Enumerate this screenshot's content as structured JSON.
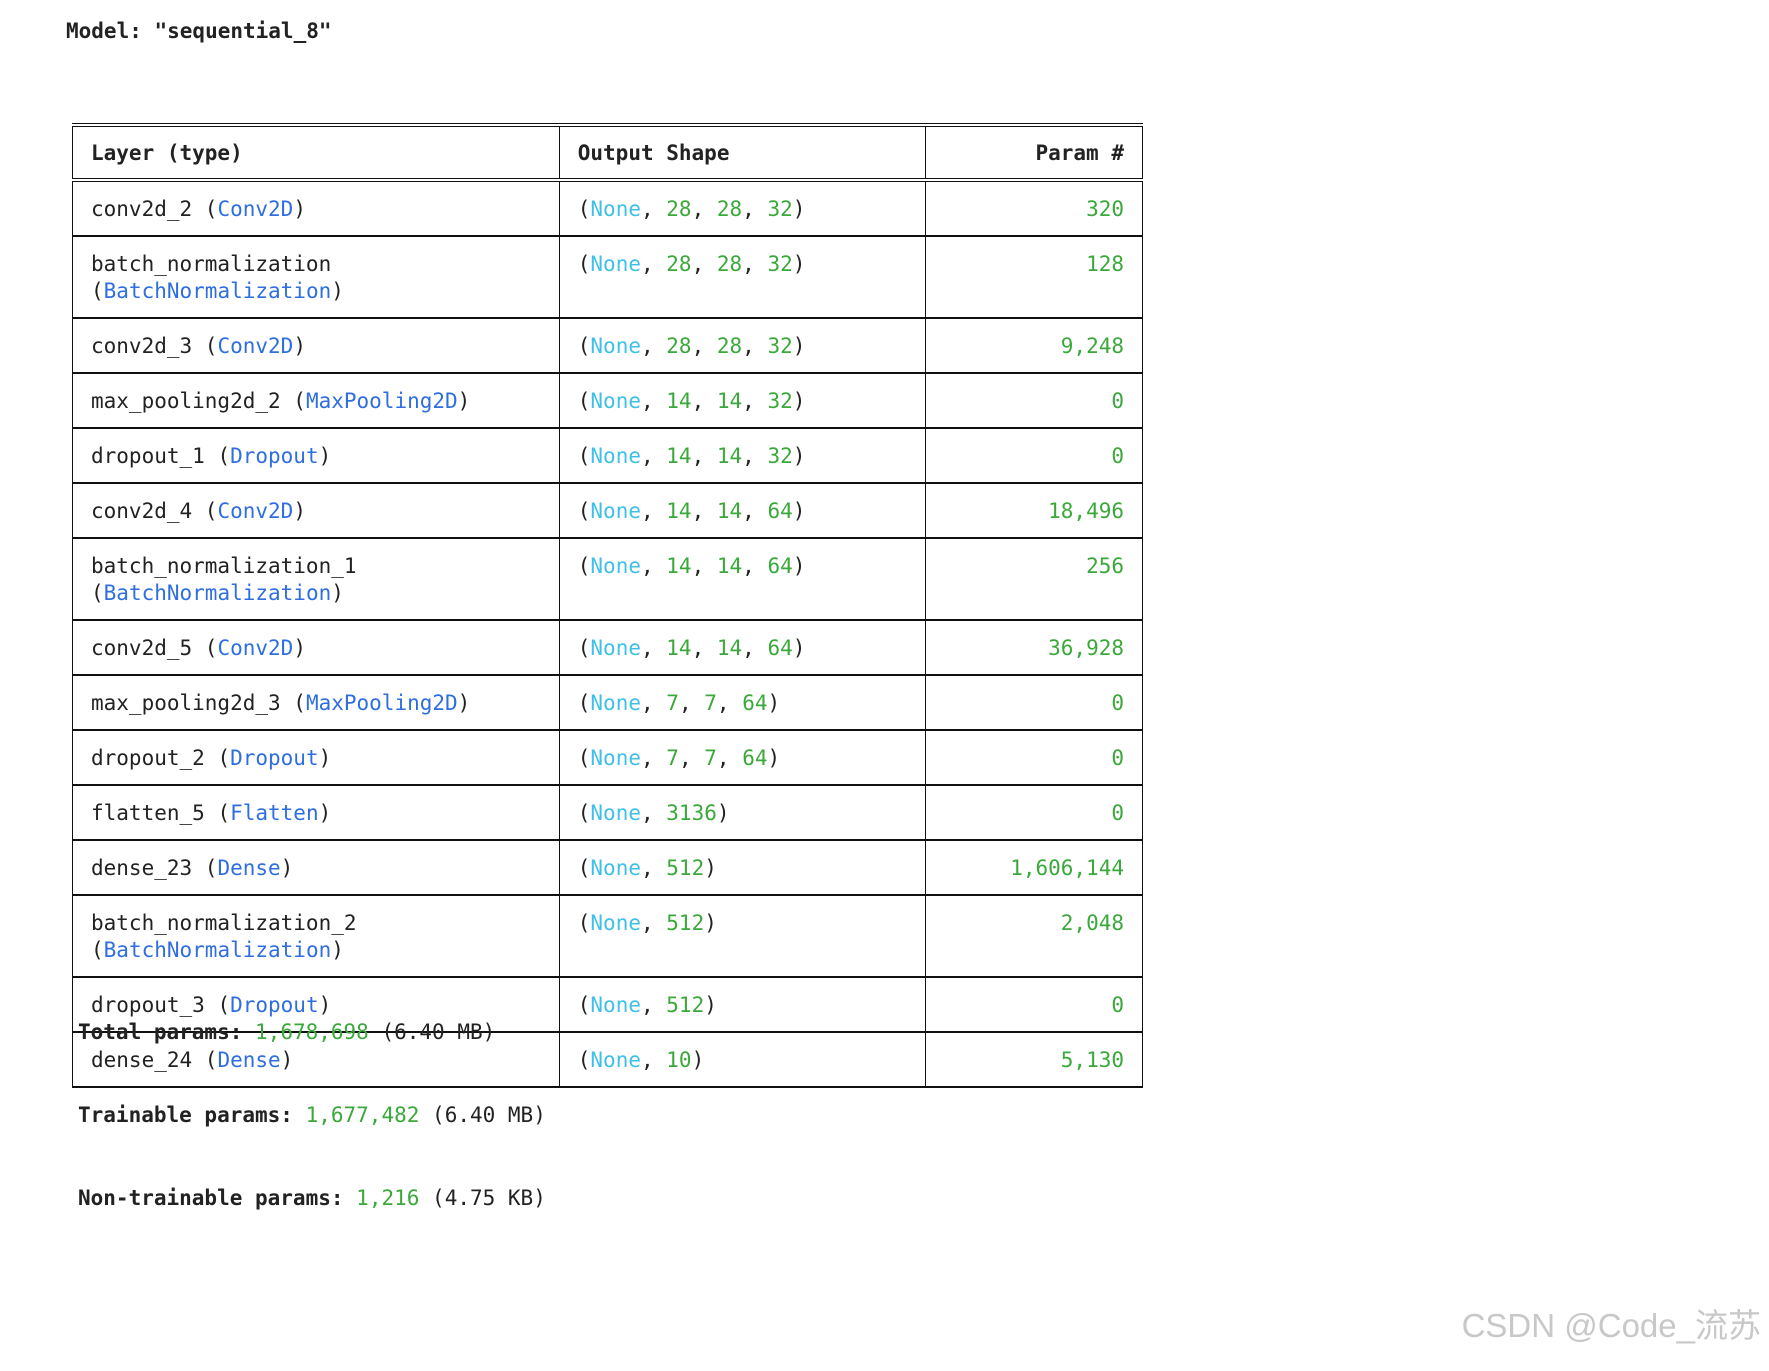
{
  "title": "Model: \"sequential_8\"",
  "headers": {
    "layer": "Layer (type)",
    "shape": "Output Shape",
    "param": "Param #"
  },
  "layers": [
    {
      "name": "conv2d_2",
      "type": "Conv2D",
      "shape": [
        "None",
        "28",
        "28",
        "32"
      ],
      "params": "320",
      "tall": false
    },
    {
      "name": "batch_normalization",
      "type": "BatchNormalization",
      "shape": [
        "None",
        "28",
        "28",
        "32"
      ],
      "params": "128",
      "tall": true
    },
    {
      "name": "conv2d_3",
      "type": "Conv2D",
      "shape": [
        "None",
        "28",
        "28",
        "32"
      ],
      "params": "9,248",
      "tall": false
    },
    {
      "name": "max_pooling2d_2",
      "type": "MaxPooling2D",
      "shape": [
        "None",
        "14",
        "14",
        "32"
      ],
      "params": "0",
      "tall": false
    },
    {
      "name": "dropout_1",
      "type": "Dropout",
      "shape": [
        "None",
        "14",
        "14",
        "32"
      ],
      "params": "0",
      "tall": false
    },
    {
      "name": "conv2d_4",
      "type": "Conv2D",
      "shape": [
        "None",
        "14",
        "14",
        "64"
      ],
      "params": "18,496",
      "tall": false
    },
    {
      "name": "batch_normalization_1",
      "type": "BatchNormalization",
      "shape": [
        "None",
        "14",
        "14",
        "64"
      ],
      "params": "256",
      "tall": true
    },
    {
      "name": "conv2d_5",
      "type": "Conv2D",
      "shape": [
        "None",
        "14",
        "14",
        "64"
      ],
      "params": "36,928",
      "tall": false
    },
    {
      "name": "max_pooling2d_3",
      "type": "MaxPooling2D",
      "shape": [
        "None",
        "7",
        "7",
        "64"
      ],
      "params": "0",
      "tall": false
    },
    {
      "name": "dropout_2",
      "type": "Dropout",
      "shape": [
        "None",
        "7",
        "7",
        "64"
      ],
      "params": "0",
      "tall": false
    },
    {
      "name": "flatten_5",
      "type": "Flatten",
      "shape": [
        "None",
        "3136"
      ],
      "params": "0",
      "tall": false
    },
    {
      "name": "dense_23",
      "type": "Dense",
      "shape": [
        "None",
        "512"
      ],
      "params": "1,606,144",
      "tall": false
    },
    {
      "name": "batch_normalization_2",
      "type": "BatchNormalization",
      "shape": [
        "None",
        "512"
      ],
      "params": "2,048",
      "tall": true
    },
    {
      "name": "dropout_3",
      "type": "Dropout",
      "shape": [
        "None",
        "512"
      ],
      "params": "0",
      "tall": false
    },
    {
      "name": "dense_24",
      "type": "Dense",
      "shape": [
        "None",
        "10"
      ],
      "params": "5,130",
      "tall": false
    }
  ],
  "totals": {
    "total": {
      "label": "Total params:",
      "value": "1,678,698",
      "size": "(6.40 MB)"
    },
    "trainable": {
      "label": "Trainable params:",
      "value": "1,677,482",
      "size": "(6.40 MB)"
    },
    "non_trainable": {
      "label": "Non-trainable params:",
      "value": "1,216",
      "size": "(4.75 KB)"
    }
  },
  "watermark": "CSDN @Code_流苏",
  "colors": {
    "type": "#2f6ee0",
    "none": "#40c0e8",
    "number": "#3aa83a"
  }
}
